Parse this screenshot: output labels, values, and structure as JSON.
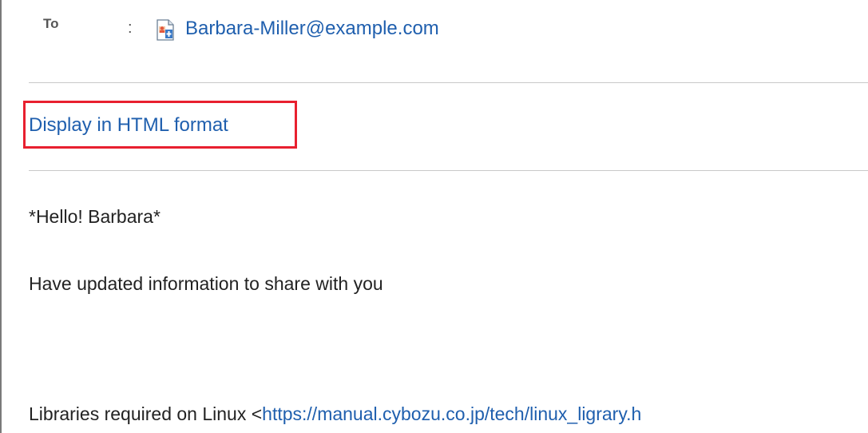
{
  "header": {
    "to_label": "To",
    "separator": ":",
    "recipient_email": "Barbara-Miller@example.com",
    "recipient_icon": "contact-card-icon"
  },
  "format_toggle": {
    "label": "Display in HTML format",
    "highlight_color": "#e8202f"
  },
  "message": {
    "greeting": "*Hello! Barbara*",
    "info": "Have updated information to share with you",
    "libraries_prefix": "Libraries required on Linux <",
    "libraries_url": "https://manual.cybozu.co.jp/tech/linux_ligrary.h"
  },
  "colors": {
    "link": "#1f5fae",
    "text": "#222222",
    "divider": "#c9c9c9"
  }
}
